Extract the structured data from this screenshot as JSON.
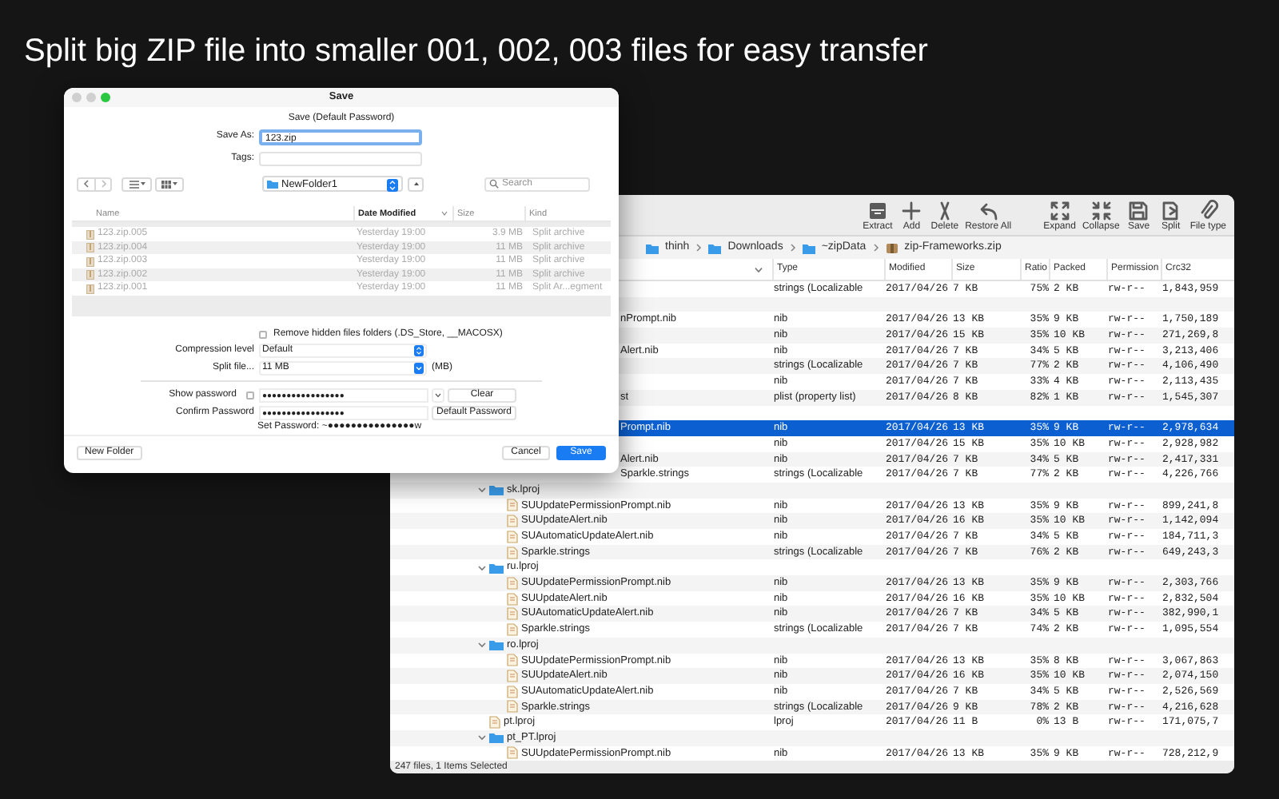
{
  "headline": "Split big ZIP file into smaller 001, 002, 003 files for easy transfer",
  "archive_window": {
    "toolbar": [
      {
        "label": "Extract"
      },
      {
        "label": "Add"
      },
      {
        "label": "Delete"
      },
      {
        "label": "Restore All"
      },
      {
        "label": "Expand"
      },
      {
        "label": "Collapse"
      },
      {
        "label": "Save"
      },
      {
        "label": "Split"
      },
      {
        "label": "File type"
      }
    ],
    "breadcrumb": [
      "thinh",
      "Downloads",
      "~zipData",
      "zip-Frameworks.zip"
    ],
    "columns": [
      "Type",
      "Modified",
      "Size",
      "Ratio",
      "Packed",
      "Permission",
      "Crc32"
    ],
    "tree": [
      {
        "type": "strings (Localizable",
        "modified": "2017/04/26",
        "size": "7 KB",
        "ratio": "75%",
        "packed": "2 KB",
        "permission": "rw-r--",
        "crc32": "1,843,959",
        "selected": false
      },
      {
        "selected": false,
        "children": [
          {
            "name": "nPrompt.nib",
            "cut": true,
            "type": "nib",
            "modified": "2017/04/26",
            "size": "13 KB",
            "ratio": "35%",
            "packed": "9 KB",
            "permission": "rw-r--",
            "crc32": "1,750,189",
            "selected": false
          },
          {
            "type": "nib",
            "modified": "2017/04/26",
            "size": "15 KB",
            "ratio": "35%",
            "packed": "10 KB",
            "permission": "rw-r--",
            "crc32": "271,269,8",
            "selected": false
          },
          {
            "name": "Alert.nib",
            "cut": true,
            "type": "nib",
            "modified": "2017/04/26",
            "size": "7 KB",
            "ratio": "34%",
            "packed": "5 KB",
            "permission": "rw-r--",
            "crc32": "3,213,406",
            "selected": false
          },
          {
            "type": "strings (Localizable",
            "modified": "2017/04/26",
            "size": "7 KB",
            "ratio": "77%",
            "packed": "2 KB",
            "permission": "rw-r--",
            "crc32": "4,106,490",
            "selected": false
          },
          {
            "type": "nib",
            "modified": "2017/04/26",
            "size": "7 KB",
            "ratio": "33%",
            "packed": "4 KB",
            "permission": "rw-r--",
            "crc32": "2,113,435",
            "selected": false
          },
          {
            "name": "st",
            "cut": true,
            "type": "plist (property list)",
            "modified": "2017/04/26",
            "size": "8 KB",
            "ratio": "82%",
            "packed": "1 KB",
            "permission": "rw-r--",
            "crc32": "1,545,307",
            "selected": false
          }
        ]
      },
      {
        "selected": false,
        "children": [
          {
            "name": "Prompt.nib",
            "cut": true,
            "type": "nib",
            "modified": "2017/04/26",
            "size": "13 KB",
            "ratio": "35%",
            "packed": "9 KB",
            "permission": "rw-r--",
            "crc32": "2,978,634",
            "selected": true
          },
          {
            "type": "nib",
            "modified": "2017/04/26",
            "size": "15 KB",
            "ratio": "35%",
            "packed": "10 KB",
            "permission": "rw-r--",
            "crc32": "2,928,982",
            "selected": false
          },
          {
            "name": "Alert.nib",
            "cut": true,
            "type": "nib",
            "modified": "2017/04/26",
            "size": "7 KB",
            "ratio": "34%",
            "packed": "5 KB",
            "permission": "rw-r--",
            "crc32": "2,417,331",
            "selected": false
          },
          {
            "name": "Sparkle.strings",
            "cut": true,
            "type": "strings (Localizable",
            "modified": "2017/04/26",
            "size": "7 KB",
            "ratio": "77%",
            "packed": "2 KB",
            "permission": "rw-r--",
            "crc32": "4,226,766",
            "selected": false
          }
        ]
      },
      {
        "kind": "folder",
        "name": "sk.lproj",
        "expanded": true,
        "selected": false,
        "children": [
          {
            "kind": "file",
            "name": "SUUpdatePermissionPrompt.nib",
            "type": "nib",
            "modified": "2017/04/26",
            "size": "13 KB",
            "ratio": "35%",
            "packed": "9 KB",
            "permission": "rw-r--",
            "crc32": "899,241,8",
            "selected": false
          },
          {
            "kind": "file",
            "name": "SUUpdateAlert.nib",
            "type": "nib",
            "modified": "2017/04/26",
            "size": "16 KB",
            "ratio": "35%",
            "packed": "10 KB",
            "permission": "rw-r--",
            "crc32": "1,142,094",
            "selected": false
          },
          {
            "kind": "file",
            "name": "SUAutomaticUpdateAlert.nib",
            "type": "nib",
            "modified": "2017/04/26",
            "size": "7 KB",
            "ratio": "34%",
            "packed": "5 KB",
            "permission": "rw-r--",
            "crc32": "184,711,3",
            "selected": false
          },
          {
            "kind": "file",
            "name": "Sparkle.strings",
            "type": "strings (Localizable",
            "modified": "2017/04/26",
            "size": "7 KB",
            "ratio": "76%",
            "packed": "2 KB",
            "permission": "rw-r--",
            "crc32": "649,243,3",
            "selected": false
          }
        ]
      },
      {
        "kind": "folder",
        "name": "ru.lproj",
        "expanded": true,
        "selected": false,
        "children": [
          {
            "kind": "file",
            "name": "SUUpdatePermissionPrompt.nib",
            "type": "nib",
            "modified": "2017/04/26",
            "size": "13 KB",
            "ratio": "35%",
            "packed": "9 KB",
            "permission": "rw-r--",
            "crc32": "2,303,766",
            "selected": false
          },
          {
            "kind": "file",
            "name": "SUUpdateAlert.nib",
            "type": "nib",
            "modified": "2017/04/26",
            "size": "16 KB",
            "ratio": "35%",
            "packed": "10 KB",
            "permission": "rw-r--",
            "crc32": "2,832,504",
            "selected": false
          },
          {
            "kind": "file",
            "name": "SUAutomaticUpdateAlert.nib",
            "type": "nib",
            "modified": "2017/04/26",
            "size": "7 KB",
            "ratio": "34%",
            "packed": "5 KB",
            "permission": "rw-r--",
            "crc32": "382,990,1",
            "selected": false
          },
          {
            "kind": "file",
            "name": "Sparkle.strings",
            "type": "strings (Localizable",
            "modified": "2017/04/26",
            "size": "7 KB",
            "ratio": "74%",
            "packed": "2 KB",
            "permission": "rw-r--",
            "crc32": "1,095,554",
            "selected": false
          }
        ]
      },
      {
        "kind": "folder",
        "name": "ro.lproj",
        "expanded": true,
        "selected": false,
        "children": [
          {
            "kind": "file",
            "name": "SUUpdatePermissionPrompt.nib",
            "type": "nib",
            "modified": "2017/04/26",
            "size": "13 KB",
            "ratio": "35%",
            "packed": "8 KB",
            "permission": "rw-r--",
            "crc32": "3,067,863",
            "selected": false
          },
          {
            "kind": "file",
            "name": "SUUpdateAlert.nib",
            "type": "nib",
            "modified": "2017/04/26",
            "size": "16 KB",
            "ratio": "35%",
            "packed": "10 KB",
            "permission": "rw-r--",
            "crc32": "2,074,150",
            "selected": false
          },
          {
            "kind": "file",
            "name": "SUAutomaticUpdateAlert.nib",
            "type": "nib",
            "modified": "2017/04/26",
            "size": "7 KB",
            "ratio": "34%",
            "packed": "5 KB",
            "permission": "rw-r--",
            "crc32": "2,526,569",
            "selected": false
          },
          {
            "kind": "file",
            "name": "Sparkle.strings",
            "type": "strings (Localizable",
            "modified": "2017/04/26",
            "size": "9 KB",
            "ratio": "78%",
            "packed": "2 KB",
            "permission": "rw-r--",
            "crc32": "4,216,628",
            "selected": false
          }
        ]
      },
      {
        "kind": "file",
        "name": "pt.lproj",
        "type": "lproj",
        "modified": "2017/04/26",
        "size": "11 B",
        "ratio": "0%",
        "packed": "13 B",
        "permission": "rw-r--",
        "crc32": "171,075,7",
        "selected": false
      },
      {
        "kind": "folder",
        "name": "pt_PT.lproj",
        "expanded": true,
        "selected": false,
        "children": [
          {
            "kind": "file",
            "name": "SUUpdatePermissionPrompt.nib",
            "type": "nib",
            "modified": "2017/04/26",
            "size": "13 KB",
            "ratio": "35%",
            "packed": "9 KB",
            "permission": "rw-r--",
            "crc32": "728,212,9",
            "selected": false
          }
        ]
      }
    ],
    "status_bar": "247 files, 1 Items Selected"
  },
  "save_dialog": {
    "title": "Save",
    "subtitle": "Save (Default Password)",
    "save_as": {
      "label": "Save As:",
      "value": "123.zip",
      "focused": true
    },
    "tags": {
      "label": "Tags:"
    },
    "folder": "NewFolder1",
    "search": {
      "placeholder": "Search"
    },
    "columns": [
      {
        "label": "Name",
        "sorted": false
      },
      {
        "label": "Date Modified",
        "sorted": true
      },
      {
        "label": "Size",
        "sorted": false
      },
      {
        "label": "Kind",
        "sorted": false
      }
    ],
    "files": [
      {
        "name": "123.zip.005",
        "modified": "Yesterday 19:00",
        "size": "3.9 MB",
        "kind": "Split archive"
      },
      {
        "name": "123.zip.004",
        "modified": "Yesterday 19:00",
        "size": "11 MB",
        "kind": "Split archive"
      },
      {
        "name": "123.zip.003",
        "modified": "Yesterday 19:00",
        "size": "11 MB",
        "kind": "Split archive"
      },
      {
        "name": "123.zip.002",
        "modified": "Yesterday 19:00",
        "size": "11 MB",
        "kind": "Split archive"
      },
      {
        "name": "123.zip.001",
        "modified": "Yesterday 19:00",
        "size": "11 MB",
        "kind": "Split Ar...egment"
      }
    ],
    "remove_hidden": {
      "label": "Remove hidden files folders (.DS_Store, __MACOSX)",
      "checked": false
    },
    "compression": {
      "label": "Compression level",
      "value": "Default"
    },
    "split": {
      "label": "Split file...",
      "value": "11 MB",
      "unit": "(MB)"
    },
    "show_password": {
      "label": "Show password",
      "checked": false,
      "value": "●●●●●●●●●●●●●●●●●"
    },
    "clear_button": "Clear",
    "confirm_password": {
      "label": "Confirm Password",
      "value": "●●●●●●●●●●●●●●●●●"
    },
    "default_password_button": "Default Password",
    "set_password": "Set Password: ~●●●●●●●●●●●●●●●w",
    "new_folder_button": "New Folder",
    "cancel_button": "Cancel",
    "save_button": "Save"
  }
}
